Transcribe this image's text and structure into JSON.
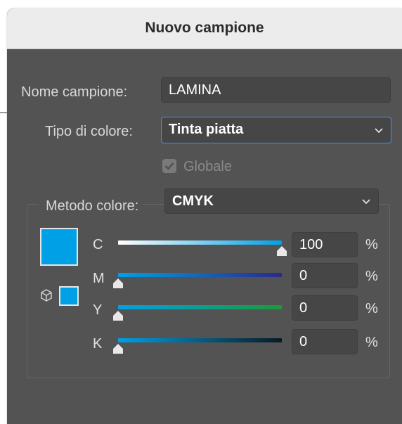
{
  "dialog": {
    "title": "Nuovo campione"
  },
  "form": {
    "name_label": "Nome campione:",
    "name_value": "LAMINA",
    "color_type_label": "Tipo di colore:",
    "color_type_value": "Tinta piatta",
    "global_label": "Globale",
    "global_checked": true,
    "global_disabled": true,
    "color_mode_label": "Metodo colore:",
    "color_mode_value": "CMYK"
  },
  "channels": [
    {
      "letter": "C",
      "value": "100",
      "unit": "%",
      "level": 1.0
    },
    {
      "letter": "M",
      "value": "0",
      "unit": "%",
      "level": 0.0
    },
    {
      "letter": "Y",
      "value": "0",
      "unit": "%",
      "level": 0.0
    },
    {
      "letter": "K",
      "value": "0",
      "unit": "%",
      "level": 0.0
    }
  ],
  "colors": {
    "swatch": "#00a0e6",
    "focus_border": "#4a8fe0"
  }
}
